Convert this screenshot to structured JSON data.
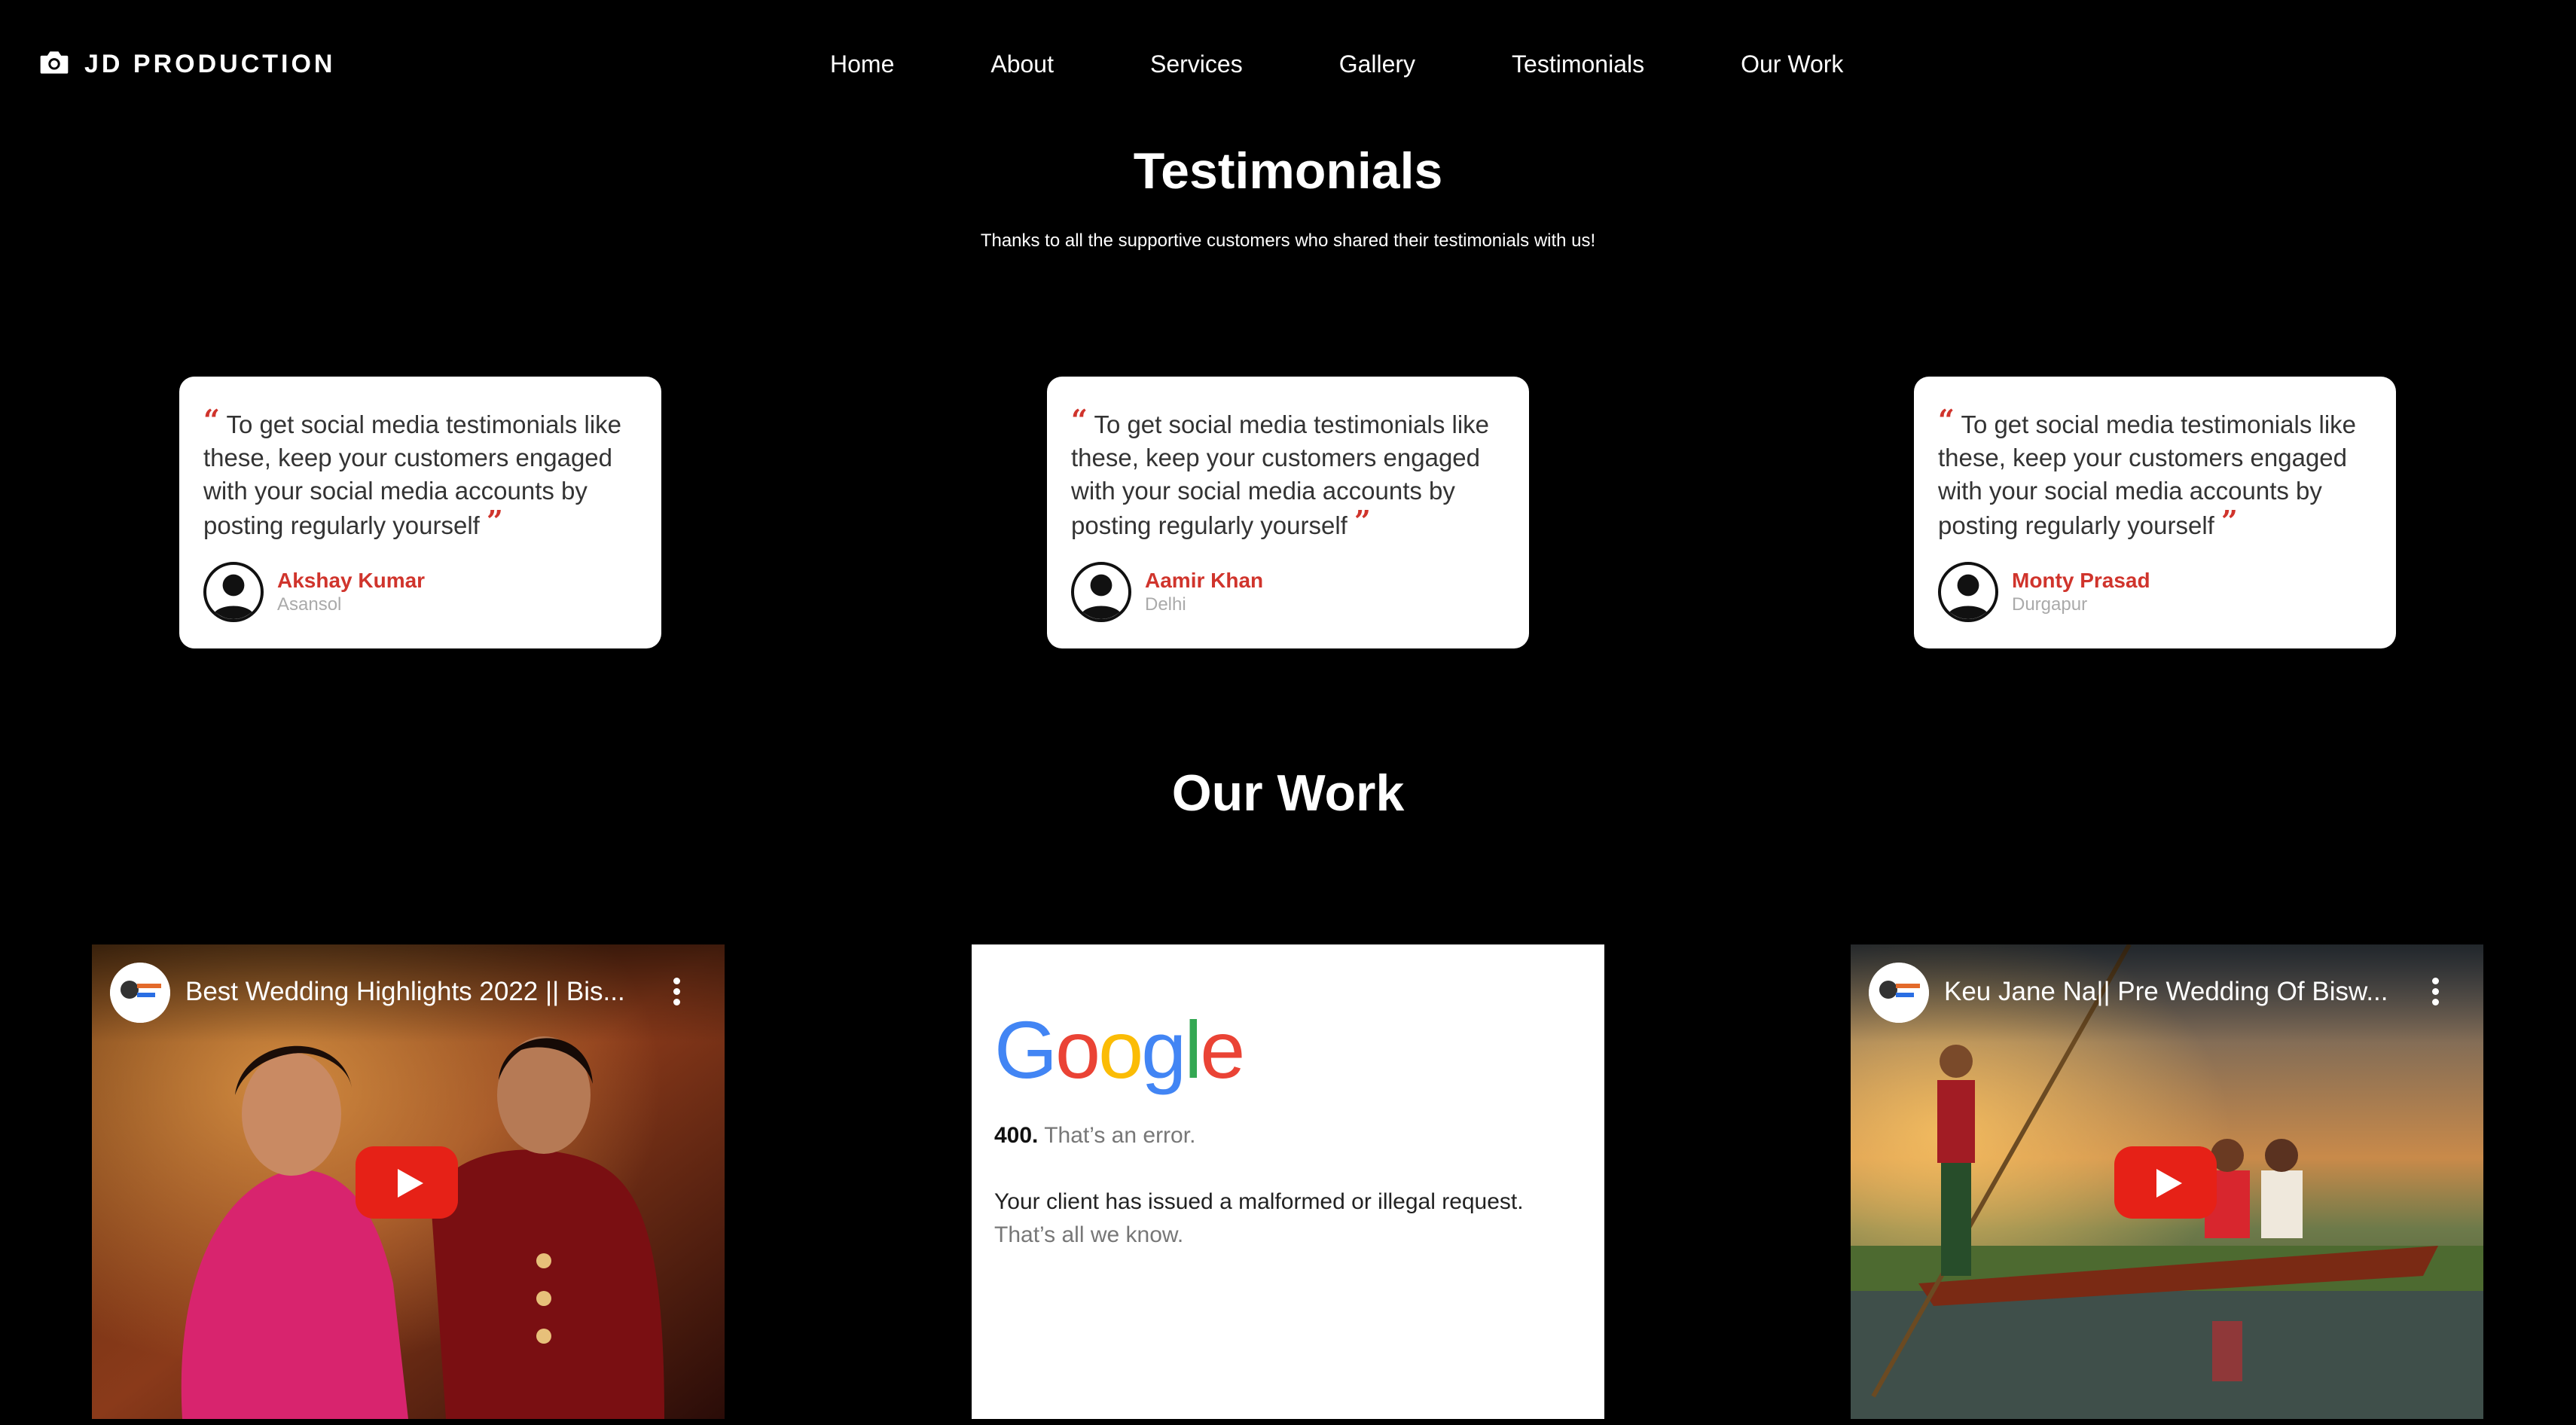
{
  "brand": {
    "name": "JD PRODUCTION",
    "icon": "camera-icon"
  },
  "nav": {
    "items": [
      "Home",
      "About",
      "Services",
      "Gallery",
      "Testimonials",
      "Our Work"
    ]
  },
  "testimonials": {
    "title": "Testimonials",
    "subtitle": "Thanks to all the supportive customers who shared their testimonials with us!",
    "quote_open": "“",
    "quote_close": "”",
    "items": [
      {
        "quote": "To get social media testimonials like these, keep your customers engaged with your social media accounts by posting regularly yourself",
        "name": "Akshay Kumar",
        "city": "Asansol"
      },
      {
        "quote": "To get social media testimonials like these, keep your customers engaged with your social media accounts by posting regularly yourself",
        "name": "Aamir Khan",
        "city": "Delhi"
      },
      {
        "quote": "To get social media testimonials like these, keep your customers engaged with your social media accounts by posting regularly yourself",
        "name": "Monty Prasad",
        "city": "Durgapur"
      }
    ]
  },
  "our_work": {
    "title": "Our Work",
    "videos": [
      {
        "title": "Best Wedding Highlights 2022 || Bis..."
      },
      {
        "title": "Keu Jane Na|| Pre Wedding Of Bisw..."
      }
    ],
    "error_embed": {
      "logo_letters": [
        "G",
        "o",
        "o",
        "g",
        "l",
        "e"
      ],
      "logo_colors": [
        "#4285F4",
        "#EA4335",
        "#FBBC05",
        "#4285F4",
        "#34A853",
        "#EA4335"
      ],
      "code": "400.",
      "code_text": "That’s an error.",
      "message": "Your client has issued a malformed or illegal request.",
      "message_2": "That’s all we know."
    }
  },
  "colors": {
    "background": "#000000",
    "accent": "#d0342c",
    "play_button": "#e62117"
  }
}
